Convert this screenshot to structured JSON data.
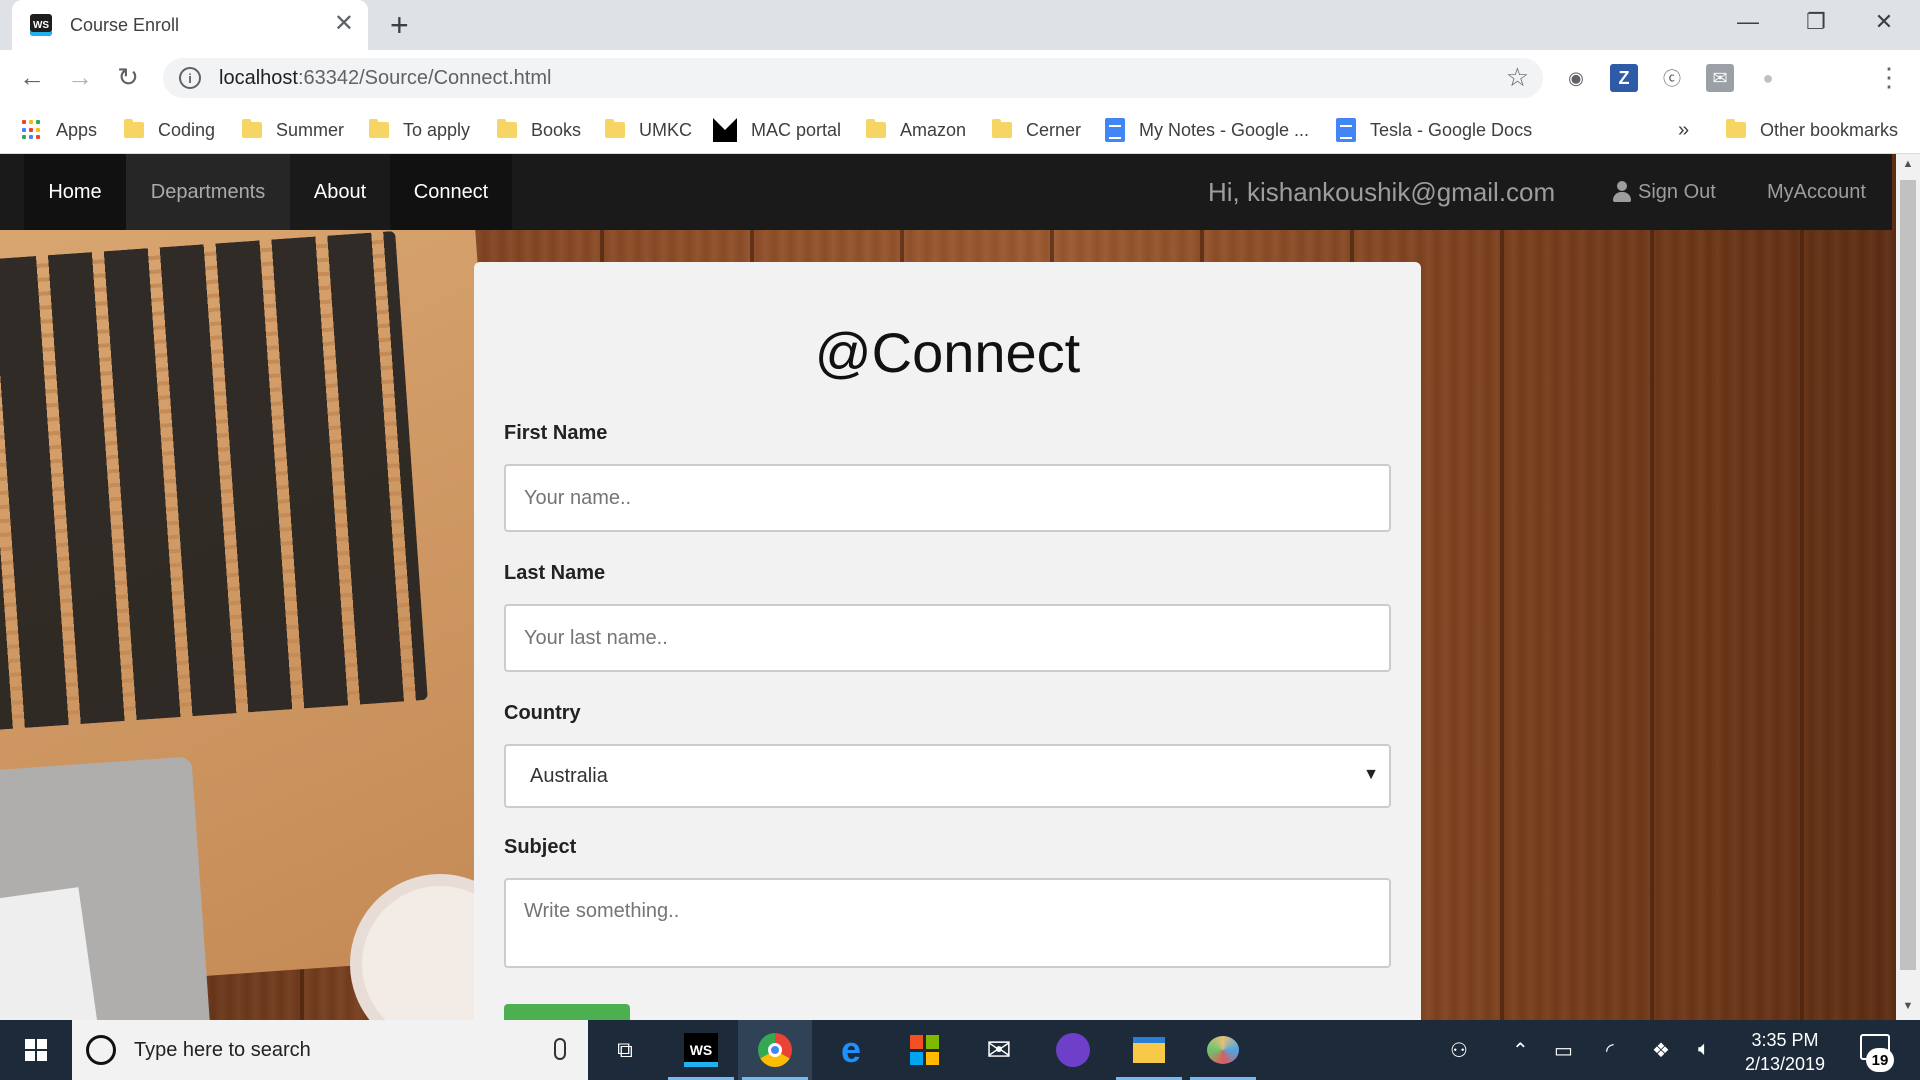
{
  "browser": {
    "tab_title": "Course Enroll",
    "tab_favicon": "WS",
    "url_host": "localhost",
    "url_path": ":63342/Source/Connect.html",
    "bookmarks": [
      {
        "label": "Apps",
        "icon": "apps-icon"
      },
      {
        "label": "Coding",
        "icon": "folder-icon"
      },
      {
        "label": "Summer",
        "icon": "folder-icon"
      },
      {
        "label": "To apply",
        "icon": "folder-icon"
      },
      {
        "label": "Books",
        "icon": "folder-icon"
      },
      {
        "label": "UMKC",
        "icon": "folder-icon"
      },
      {
        "label": "MAC portal",
        "icon": "mac-icon"
      },
      {
        "label": "Amazon",
        "icon": "folder-icon"
      },
      {
        "label": "Cerner",
        "icon": "folder-icon"
      },
      {
        "label": "My Notes - Google ...",
        "icon": "docs-icon"
      },
      {
        "label": "Tesla - Google Docs",
        "icon": "docs-icon"
      }
    ],
    "overflow": "»",
    "other_bookmarks": "Other bookmarks",
    "extension_z": "Z"
  },
  "navbar": {
    "items": [
      "Home",
      "Departments",
      "About",
      "Connect"
    ],
    "greeting": "Hi, kishankoushik@gmail.com",
    "sign_out": "Sign Out",
    "my_account": "MyAccount"
  },
  "form": {
    "title": "@Connect",
    "first_name_label": "First Name",
    "first_name_placeholder": "Your name..",
    "last_name_label": "Last Name",
    "last_name_placeholder": "Your last name..",
    "country_label": "Country",
    "country_value": "Australia",
    "subject_label": "Subject",
    "subject_placeholder": "Write something.."
  },
  "taskbar": {
    "search_placeholder": "Type here to search",
    "time": "3:35 PM",
    "date": "2/13/2019",
    "notification_count": "19"
  },
  "colors": {
    "navbar_bg": "#1a1a1a",
    "card_bg": "#f2f2f2",
    "submit_green": "#4caf50",
    "taskbar_bg": "#1c2a3a"
  }
}
